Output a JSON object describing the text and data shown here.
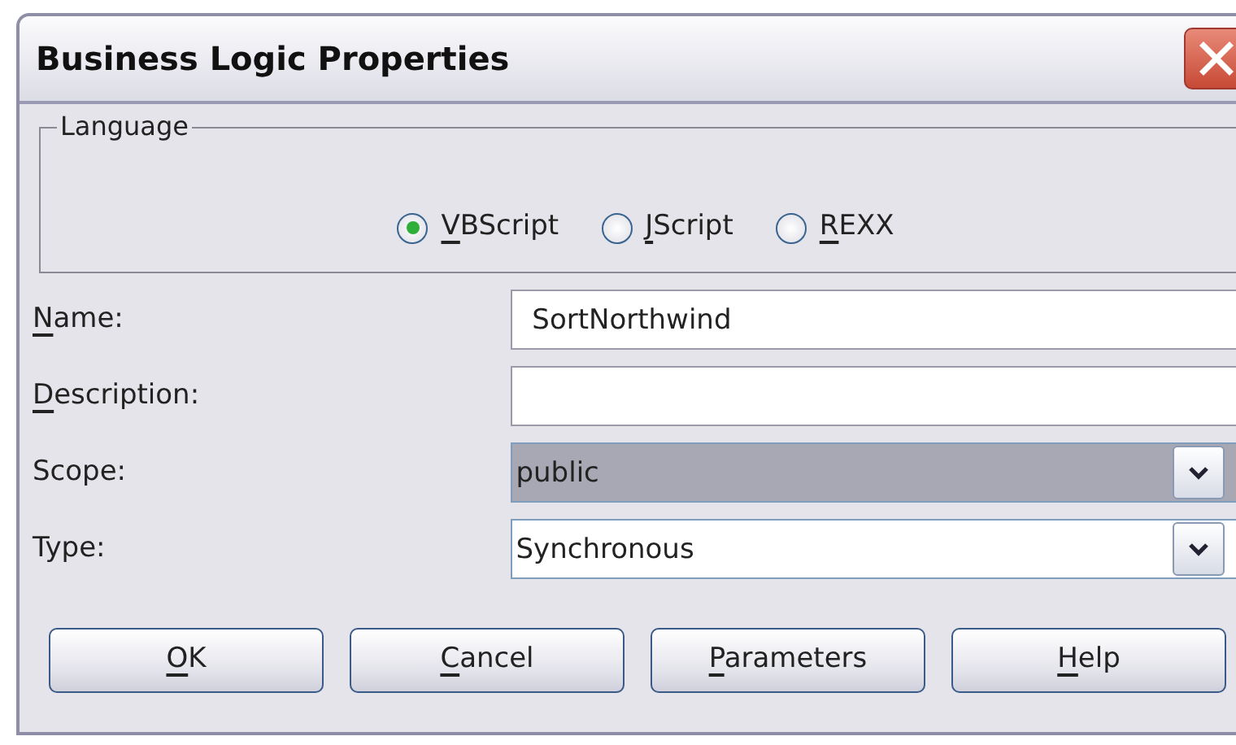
{
  "window": {
    "title": "Business Logic Properties"
  },
  "language": {
    "legend": "Language",
    "options": [
      {
        "label": "VBScript",
        "mnemonic_underlined": true,
        "selected": true
      },
      {
        "label": "JScript",
        "mnemonic_underlined": true,
        "selected": false
      },
      {
        "label": "REXX",
        "mnemonic_underlined": true,
        "selected": false
      }
    ]
  },
  "fields": [
    {
      "kind": "text",
      "label": "Name:",
      "mnemonic_underlined": true,
      "value": "SortNorthwind",
      "focused": false
    },
    {
      "kind": "text",
      "label": "Description:",
      "mnemonic_underlined": true,
      "focused": false
    },
    {
      "kind": "dropdown",
      "label": "Scope:",
      "mnemonic_underlined": false,
      "value": "public",
      "focused": true
    },
    {
      "kind": "dropdown",
      "label": "Type:",
      "mnemonic_underlined": false,
      "value": "Synchronous",
      "focused": false
    }
  ],
  "buttons": [
    {
      "label": "OK",
      "mnemonic_underlined": true
    },
    {
      "label": "Cancel",
      "mnemonic_underlined": true
    },
    {
      "label": "Parameters",
      "mnemonic_underlined": true
    },
    {
      "label": "Help",
      "mnemonic_underlined": true
    }
  ]
}
